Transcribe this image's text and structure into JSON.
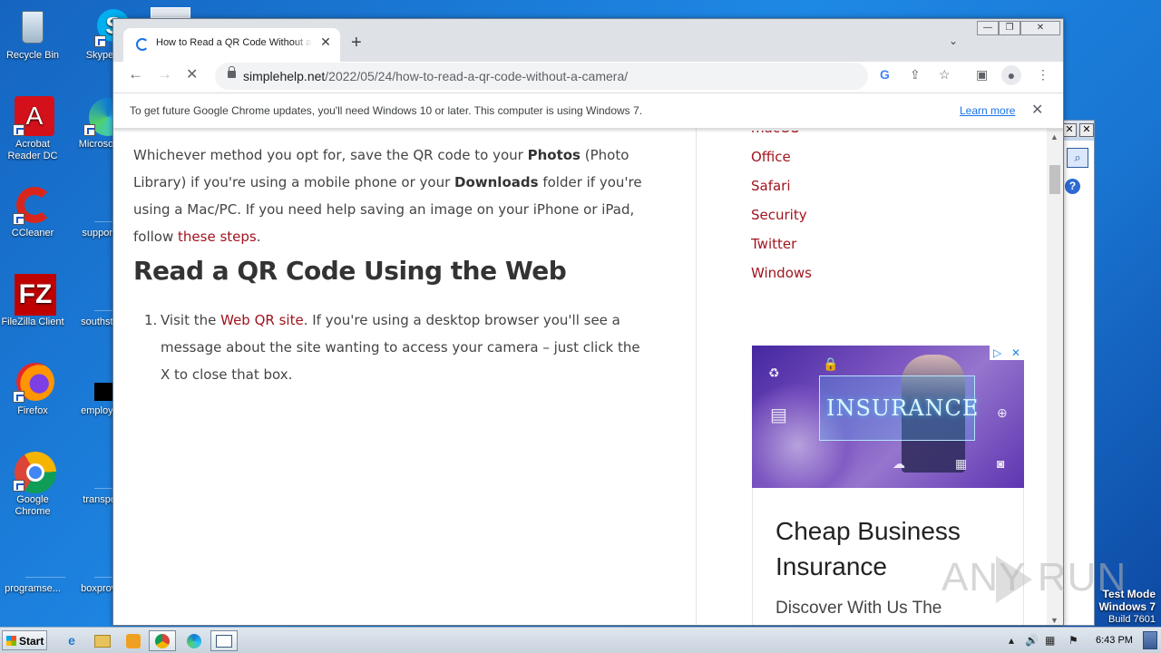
{
  "desktop": {
    "icons": [
      {
        "label": "Recycle Bin",
        "icon": "recycle-bin-icon"
      },
      {
        "label": "Skype",
        "icon": "skype-icon"
      },
      {
        "label": "Acrobat Reader DC",
        "icon": "acrobat-icon"
      },
      {
        "label": "Microsoft",
        "icon": "edge-icon"
      },
      {
        "label": "CCleaner",
        "icon": "ccleaner-icon"
      },
      {
        "label": "supportal",
        "icon": "document-icon"
      },
      {
        "label": "FileZilla Client",
        "icon": "filezilla-icon"
      },
      {
        "label": "southstep",
        "icon": "document-icon"
      },
      {
        "label": "Firefox",
        "icon": "firefox-icon"
      },
      {
        "label": "employee",
        "icon": "document-icon"
      },
      {
        "label": "Google Chrome",
        "icon": "chrome-icon"
      },
      {
        "label": "transport",
        "icon": "document-icon"
      },
      {
        "label": "programse...",
        "icon": "document-icon"
      },
      {
        "label": "boxprovid",
        "icon": "document-icon"
      }
    ]
  },
  "browser": {
    "tab_title": "How to Read a QR Code Without a Camera",
    "new_tab": "+",
    "tab_close": "✕",
    "url_host": "simplehelp.net",
    "url_path": "/2022/05/24/how-to-read-a-qr-code-without-a-camera/",
    "infobar": {
      "message": "To get future Google Chrome updates, you'll need Windows 10 or later. This computer is using Windows 7.",
      "link": "Learn more",
      "close": "✕"
    }
  },
  "article": {
    "p1_a": "Whichever method you opt for, save the QR code to your ",
    "p1_b": "Photos",
    "p1_c": " (Photo Library) if you're using a mobile phone or your ",
    "p1_d": "Downloads",
    "p1_e": " folder if you're using a Mac/PC. If you need help saving an image on your iPhone or iPad, follow ",
    "p1_link": "these steps",
    "p1_end": ".",
    "heading": "Read a QR Code Using the Web",
    "step_num": "1.",
    "step_a": "Visit the ",
    "step_link": "Web QR site",
    "step_b": ". If you're using a desktop browser you'll see a message about the site wanting to access your camera – just click the X to close that box."
  },
  "sidebar": {
    "links": [
      "macOS",
      "Office",
      "Safari",
      "Security",
      "Twitter",
      "Windows"
    ]
  },
  "ad": {
    "banner_text": "INSURANCE",
    "headline": "Cheap Business Insurance",
    "subline": "Discover With Us The"
  },
  "watermark": "ANY RUN",
  "testmode": {
    "line1": "Test Mode",
    "line2": "Windows 7",
    "line3": "Build 7601"
  },
  "taskbar": {
    "start": "Start",
    "clock": "6:43 PM"
  }
}
